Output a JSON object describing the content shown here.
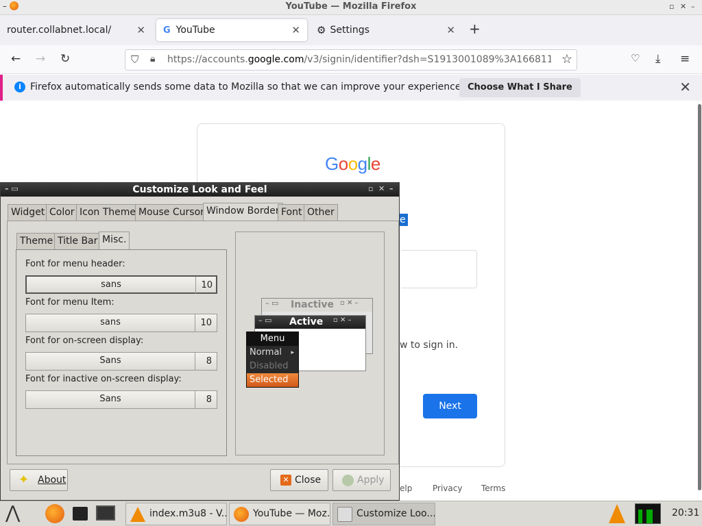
{
  "window": {
    "title": "YouTube — Mozilla Firefox"
  },
  "tabs": [
    {
      "label": "router.collabnet.local/"
    },
    {
      "label": "YouTube"
    },
    {
      "label": "Settings"
    }
  ],
  "url": {
    "pre": "https://accounts.",
    "domain": "google.com",
    "post": "/v3/signin/identifier?dsh=S1913001089%3A166811"
  },
  "notification": {
    "message": "Firefox automatically sends some data to Mozilla so that we can improve your experience.",
    "button": "Choose What I Share"
  },
  "google": {
    "logo": "Google",
    "selected_fragment": "e",
    "sign_fragment": "w to sign in.",
    "next": "Next",
    "footer": [
      "elp",
      "Privacy",
      "Terms"
    ]
  },
  "dialog": {
    "title": "Customize Look and Feel",
    "tabs": [
      "Widget",
      "Color",
      "Icon Theme",
      "Mouse Cursor",
      "Window Border",
      "Font",
      "Other"
    ],
    "subtabs": [
      "Theme",
      "Title Bar",
      "Misc."
    ],
    "fonts": [
      {
        "label": "Font for menu header:",
        "name": "sans",
        "size": "10"
      },
      {
        "label": "Font for menu Item:",
        "name": "sans",
        "size": "10"
      },
      {
        "label": "Font for on-screen display:",
        "name": "Sans",
        "size": "8"
      },
      {
        "label": "Font for inactive on-screen display:",
        "name": "Sans",
        "size": "8"
      }
    ],
    "preview": {
      "inactive": "Inactive",
      "active": "Active",
      "menu": {
        "header": "Menu",
        "items": [
          "Normal",
          "Disabled",
          "Selected"
        ]
      }
    },
    "buttons": {
      "about": "About",
      "close": "Close",
      "apply": "Apply"
    }
  },
  "taskbar": {
    "tasks": [
      "index.m3u8 - V...",
      "YouTube — Moz...",
      "Customize Loo..."
    ],
    "clock": "20:31"
  }
}
